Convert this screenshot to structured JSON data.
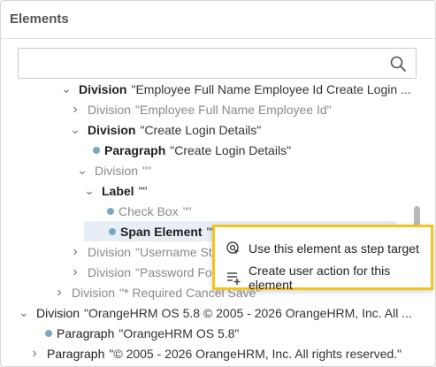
{
  "panel": {
    "title": "Elements",
    "search": {
      "value": "",
      "placeholder": ""
    }
  },
  "tree": [
    {
      "tag": "Division",
      "value": "\"Employee Full Name Employee Id Create Login ...",
      "chevron": "down",
      "style": "bold"
    },
    {
      "tag": "Division",
      "value": "\"Employee Full Name Employee Id\"",
      "chevron": "right",
      "style": "dim"
    },
    {
      "tag": "Division",
      "value": "\"Create Login Details\"",
      "chevron": "down",
      "style": "bold"
    },
    {
      "tag": "Paragraph",
      "value": "\"Create Login Details\"",
      "chevron": "dot",
      "style": "bold"
    },
    {
      "tag": "Division",
      "value": "\"\"",
      "chevron": "down",
      "style": "dim"
    },
    {
      "tag": "Label",
      "value": "\"\"",
      "chevron": "down",
      "style": "bold"
    },
    {
      "tag": "Check Box",
      "value": "\"\"",
      "chevron": "dot",
      "style": "dim"
    },
    {
      "tag": "Span Element",
      "value": "\"\"",
      "chevron": "dot",
      "style": "bold",
      "selected": true
    },
    {
      "tag": "Division",
      "value": "\"Username Statu",
      "chevron": "right",
      "style": "dim"
    },
    {
      "tag": "Division",
      "value": "\"Password For",
      "chevron": "right",
      "style": "dim"
    },
    {
      "tag": "Division",
      "value": "\"* Required Cancel Save\"",
      "chevron": "right",
      "style": "dim"
    },
    {
      "tag": "Division",
      "value": "\"OrangeHRM OS 5.8 © 2005 - 2026 OrangeHRM, Inc. All ...",
      "chevron": "down",
      "style": "plain"
    },
    {
      "tag": "Paragraph",
      "value": "\"OrangeHRM OS 5.8\"",
      "chevron": "dot",
      "style": "plain"
    },
    {
      "tag": "Paragraph",
      "value": "\"© 2005 - 2026 OrangeHRM, Inc. All rights reserved.\"",
      "chevron": "right",
      "style": "plain"
    }
  ],
  "context_menu": {
    "items": [
      {
        "label": "Use this element as step target",
        "icon": "target-icon"
      },
      {
        "label": "Create user action for this element",
        "icon": "add-list-icon"
      }
    ],
    "highlight_color": "#f2c41d"
  }
}
